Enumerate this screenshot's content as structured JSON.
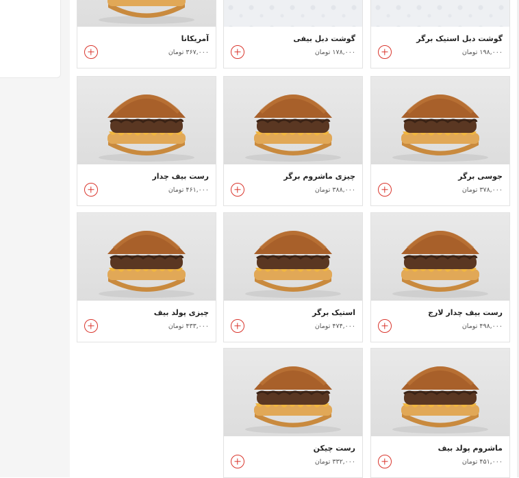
{
  "currency_label": "تومان",
  "products": [
    {
      "name": "آمریکانا",
      "price": "۳۶۷,۰۰۰",
      "photo": "burger"
    },
    {
      "name": "گوشت دبل بیفی",
      "price": "۱۷۸,۰۰۰",
      "photo": "pattern"
    },
    {
      "name": "گوشت دبل استیک برگر",
      "price": "۱۹۸,۰۰۰",
      "photo": "pattern"
    },
    {
      "name": "رست بیف چدار",
      "price": "۴۶۱,۰۰۰",
      "photo": "burger"
    },
    {
      "name": "چیزی ماشروم برگر",
      "price": "۳۸۸,۰۰۰",
      "photo": "burger"
    },
    {
      "name": "جوسی برگر",
      "price": "۳۷۸,۰۰۰",
      "photo": "burger"
    },
    {
      "name": "چیزی پولد بیف",
      "price": "۴۳۳,۰۰۰",
      "photo": "burger"
    },
    {
      "name": "استیک برگر",
      "price": "۴۷۴,۰۰۰",
      "photo": "burger"
    },
    {
      "name": "رست بیف چدار لارج",
      "price": "۴۹۸,۰۰۰",
      "photo": "burger"
    },
    {
      "name": "رست چیکن",
      "price": "۳۳۲,۰۰۰",
      "photo": "burger"
    },
    {
      "name": "ماشروم پولد بیف",
      "price": "۴۵۱,۰۰۰",
      "photo": "burger"
    }
  ]
}
